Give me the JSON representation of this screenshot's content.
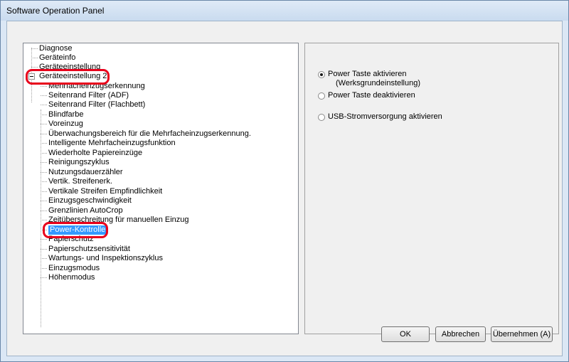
{
  "window": {
    "title": "Software Operation Panel"
  },
  "tree": {
    "items": [
      "Diagnose",
      "Geräteinfo",
      "Geräteeinstellung",
      "Geräteeinstellung 2",
      "Mehrfacheinzugserkennung",
      "Seitenrand Filter (ADF)",
      "Seitenrand Filter (Flachbett)",
      "Blindfarbe",
      "Voreinzug",
      "Überwachungsbereich für die Mehrfacheinzugserkennung.",
      "Intelligente Mehrfacheinzugsfunktion",
      "Wiederholte Papiereinzüge",
      "Reinigungszyklus",
      "Nutzungsdauerzähler",
      "Vertik. Streifenerk.",
      "Vertikale Streifen Empfindlichkeit",
      "Einzugsgeschwindigkeit",
      "Grenzlinien AutoCrop",
      "Zeitüberschreitung für manuellen Einzug",
      "Power-Kontrolle",
      "Papierschutz",
      "Papierschutzsensitivität",
      "Wartungs- und Inspektionszyklus",
      "Einzugsmodus",
      "Höhenmodus"
    ],
    "selected_index": 19
  },
  "options": {
    "radio1_line1": "Power Taste aktivieren",
    "radio1_line2": "(Werksgrundeinstellung)",
    "radio2": "Power Taste deaktivieren",
    "radio3": "USB-Stromversorgung aktivieren",
    "checked": "radio1"
  },
  "buttons": {
    "ok": "OK",
    "cancel": "Abbrechen",
    "apply": "Übernehmen (A)"
  },
  "colors": {
    "highlight_ring": "#e8001b",
    "selection": "#3399ff"
  }
}
